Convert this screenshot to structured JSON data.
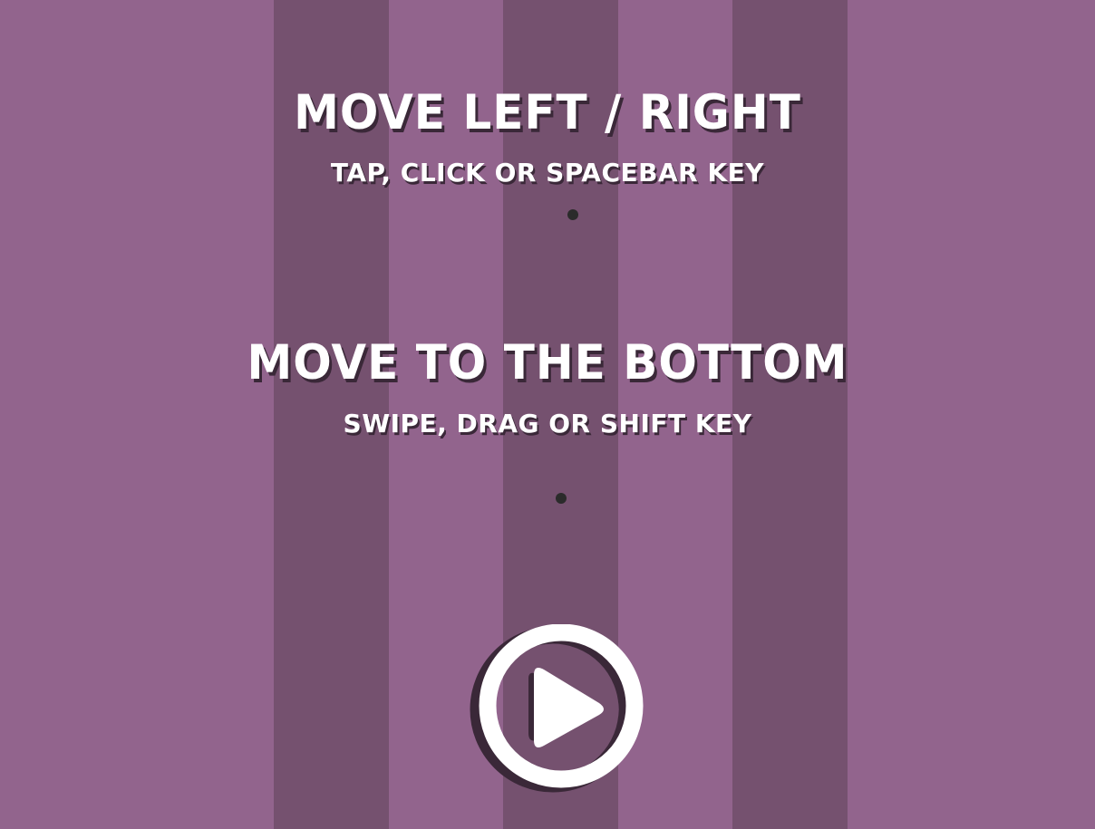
{
  "instructions": [
    {
      "title": "MOVE LEFT / RIGHT",
      "subtitle": "TAP, CLICK OR SPACEBAR KEY"
    },
    {
      "title": "MOVE TO THE BOTTOM",
      "subtitle": "SWIPE, DRAG OR SHIFT KEY"
    }
  ],
  "play_button": {
    "icon": "play-icon"
  },
  "colors": {
    "background": "#92648d",
    "stripe": "#75516f",
    "text": "#ffffff",
    "text_shadow": "#3a2838",
    "ball": "#2b2b2b",
    "button": "#ffffff"
  }
}
